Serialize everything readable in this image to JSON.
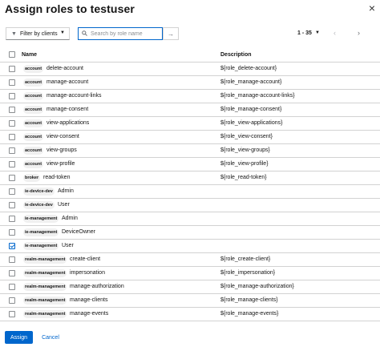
{
  "dialog": {
    "title": "Assign roles to testuser",
    "close_glyph": "×"
  },
  "toolbar": {
    "filter_label": "Filter by clients",
    "search_placeholder": "Search by role name",
    "search_value": "",
    "pagination_range": "1 - 35"
  },
  "table": {
    "headers": {
      "name": "Name",
      "description": "Description"
    },
    "rows": [
      {
        "client": "account",
        "role": "delete-account",
        "description": "${role_delete-account}",
        "checked": false
      },
      {
        "client": "account",
        "role": "manage-account",
        "description": "${role_manage-account}",
        "checked": false
      },
      {
        "client": "account",
        "role": "manage-account-links",
        "description": "${role_manage-account-links}",
        "checked": false
      },
      {
        "client": "account",
        "role": "manage-consent",
        "description": "${role_manage-consent}",
        "checked": false
      },
      {
        "client": "account",
        "role": "view-applications",
        "description": "${role_view-applications}",
        "checked": false
      },
      {
        "client": "account",
        "role": "view-consent",
        "description": "${role_view-consent}",
        "checked": false
      },
      {
        "client": "account",
        "role": "view-groups",
        "description": "${role_view-groups}",
        "checked": false
      },
      {
        "client": "account",
        "role": "view-profile",
        "description": "${role_view-profile}",
        "checked": false
      },
      {
        "client": "broker",
        "role": "read-token",
        "description": "${role_read-token}",
        "checked": false
      },
      {
        "client": "ie-device-dev",
        "role": "Admin",
        "description": "",
        "checked": false
      },
      {
        "client": "ie-device-dev",
        "role": "User",
        "description": "",
        "checked": false
      },
      {
        "client": "ie-management",
        "role": "Admin",
        "description": "",
        "checked": false
      },
      {
        "client": "ie-management",
        "role": "DeviceOwner",
        "description": "",
        "checked": false
      },
      {
        "client": "ie-management",
        "role": "User",
        "description": "",
        "checked": true
      },
      {
        "client": "realm-management",
        "role": "create-client",
        "description": "${role_create-client}",
        "checked": false
      },
      {
        "client": "realm-management",
        "role": "impersonation",
        "description": "${role_impersonation}",
        "checked": false
      },
      {
        "client": "realm-management",
        "role": "manage-authorization",
        "description": "${role_manage-authorization}",
        "checked": false
      },
      {
        "client": "realm-management",
        "role": "manage-clients",
        "description": "${role_manage-clients}",
        "checked": false
      },
      {
        "client": "realm-management",
        "role": "manage-events",
        "description": "${role_manage-events}",
        "checked": false
      }
    ]
  },
  "footer": {
    "assign_label": "Assign",
    "cancel_label": "Cancel"
  },
  "colors": {
    "primary": "#0066cc",
    "border": "#d2d2d2",
    "badge_bg": "#f0f0f0"
  },
  "icons": {
    "filter": "filter-icon",
    "search": "search-icon",
    "go": "arrow-right-icon",
    "prev": "chevron-left-icon",
    "next": "chevron-right-icon",
    "close": "close-icon"
  }
}
